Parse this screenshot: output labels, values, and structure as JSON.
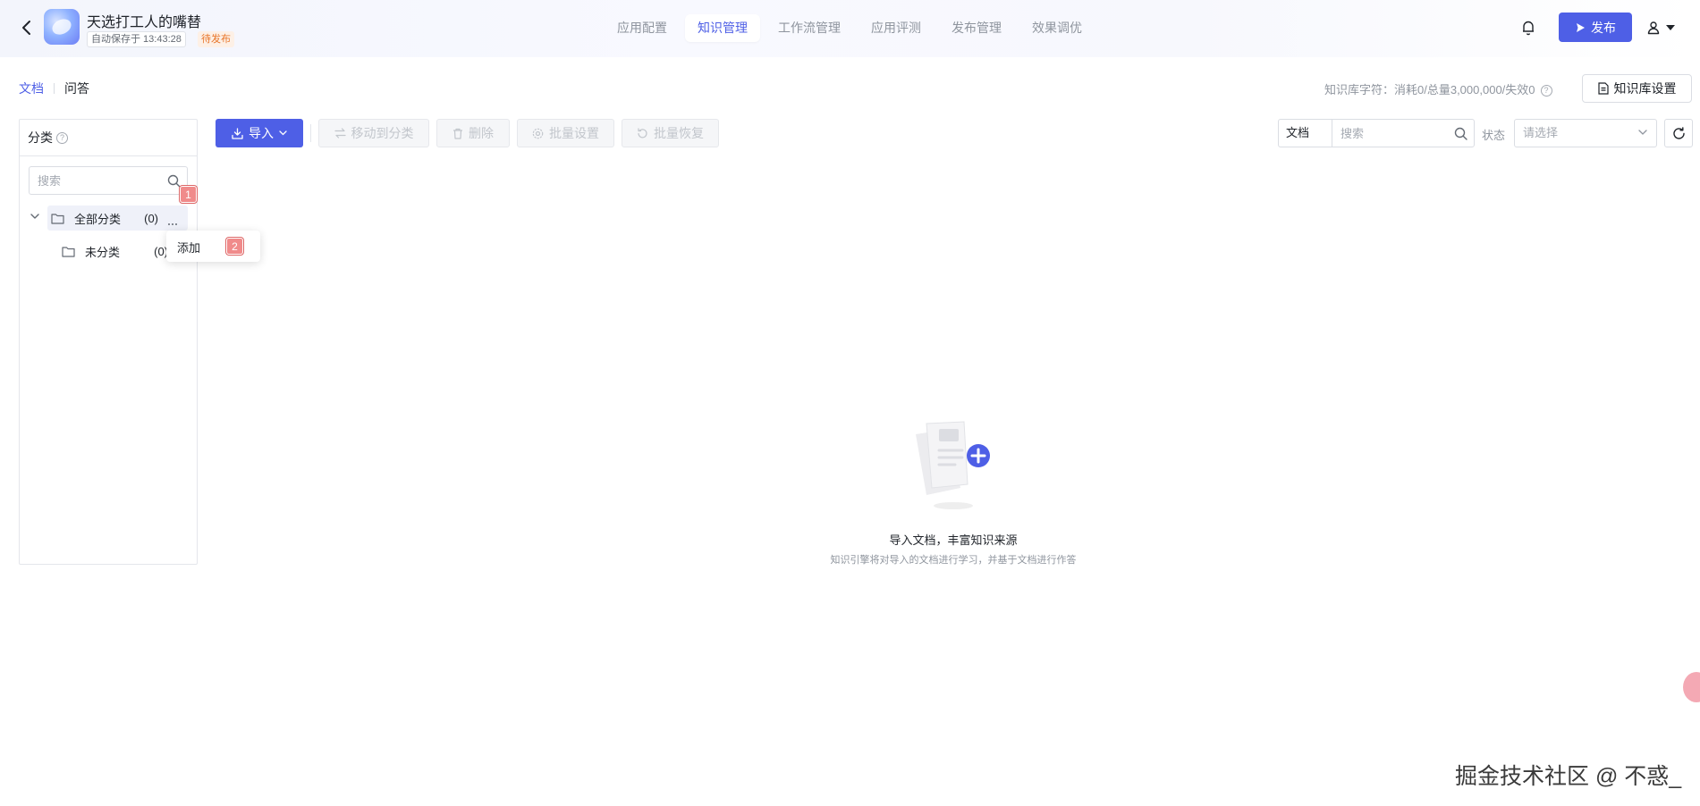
{
  "app": {
    "name": "天选打工人的嘴替",
    "autosave": "自动保存于 13:43:28",
    "status_badge": "待发布"
  },
  "nav_tabs": [
    {
      "label": "应用配置"
    },
    {
      "label": "知识管理",
      "active": true
    },
    {
      "label": "工作流管理"
    },
    {
      "label": "应用评测"
    },
    {
      "label": "发布管理"
    },
    {
      "label": "效果调优"
    }
  ],
  "header_actions": {
    "publish_label": "发布"
  },
  "doc_tabs": [
    {
      "label": "文档",
      "active": true
    },
    {
      "label": "问答"
    }
  ],
  "kb_stats": "知识库字符：消耗0/总量3,000,000/失效0",
  "kb_settings_label": "知识库设置",
  "category_panel": {
    "title": "分类",
    "search_placeholder": "搜索",
    "tree": [
      {
        "label": "全部分类",
        "count": "(0)",
        "expanded": true
      },
      {
        "label": "未分类",
        "count": "(0)"
      }
    ],
    "context_menu": {
      "add_label": "添加"
    },
    "step_badges": [
      "1",
      "2"
    ]
  },
  "toolbar": {
    "import_label": "导入",
    "move_label": "移动到分类",
    "delete_label": "删除",
    "batch_settings_label": "批量设置",
    "batch_restore_label": "批量恢复"
  },
  "filters": {
    "type_label": "文档",
    "search_placeholder": "搜索",
    "status_label": "状态",
    "status_placeholder": "请选择"
  },
  "empty_state": {
    "title": "导入文档，丰富知识来源",
    "description": "知识引擎将对导入的文档进行学习，并基于文档进行作答"
  },
  "watermark": "掘金技术社区 @ 不惑_",
  "colors": {
    "accent": "#4e5fe6",
    "badge_orange": "#e8752a",
    "step_badge": "#f08b8b"
  }
}
